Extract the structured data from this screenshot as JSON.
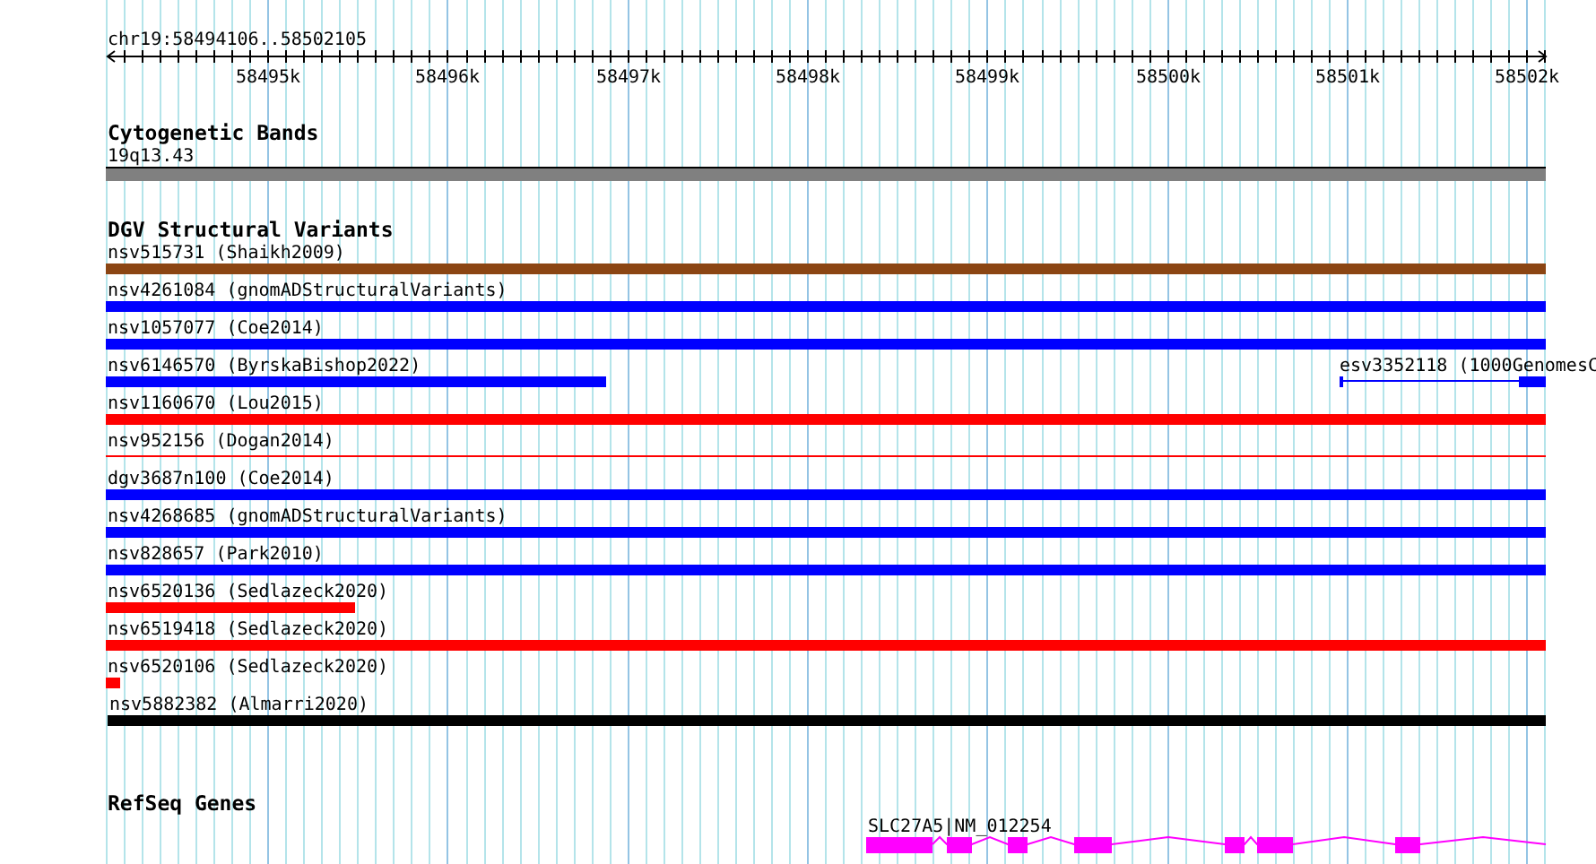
{
  "ruler": {
    "location": "chr19:58494106..58502105",
    "ticks": [
      "58495k",
      "58496k",
      "58497k",
      "58498k",
      "58499k",
      "58500k",
      "58501k",
      "58502k"
    ]
  },
  "tracks": [
    {
      "title": "Cytogenetic Bands",
      "features": [
        {
          "label": "19q13.43",
          "kind": "band"
        }
      ]
    },
    {
      "title": "DGV Structural Variants",
      "features": [
        {
          "label": "nsv515731 (Shaikh2009)",
          "kind": "bar",
          "color": "#8b4513"
        },
        {
          "label": "nsv4261084 (gnomADStructuralVariants)",
          "kind": "bar",
          "color": "#0000ff"
        },
        {
          "label": "nsv1057077 (Coe2014)",
          "kind": "bar",
          "color": "#0000ff"
        },
        {
          "label": "nsv6146570 (ByrskaBishop2022)",
          "kind": "bar",
          "color": "#0000ff"
        },
        {
          "label": "esv3352118 (1000GenomesC",
          "kind": "split",
          "color": "#0000ff"
        },
        {
          "label": "nsv1160670 (Lou2015)",
          "kind": "bar",
          "color": "#ff0000"
        },
        {
          "label": "nsv952156 (Dogan2014)",
          "kind": "line",
          "color": "#ff0000"
        },
        {
          "label": "dgv3687n100 (Coe2014)",
          "kind": "bar",
          "color": "#0000ff"
        },
        {
          "label": "nsv4268685 (gnomADStructuralVariants)",
          "kind": "bar",
          "color": "#0000ff"
        },
        {
          "label": "nsv828657 (Park2010)",
          "kind": "bar",
          "color": "#0000ff"
        },
        {
          "label": "nsv6520136 (Sedlazeck2020)",
          "kind": "bar",
          "color": "#ff0000"
        },
        {
          "label": "nsv6519418 (Sedlazeck2020)",
          "kind": "bar",
          "color": "#ff0000"
        },
        {
          "label": "nsv6520106 (Sedlazeck2020)",
          "kind": "bar",
          "color": "#ff0000"
        },
        {
          "label": "nsv5882382 (Almarri2020)",
          "kind": "bar",
          "color": "#000000"
        }
      ]
    },
    {
      "title": "RefSeq Genes",
      "features": [
        {
          "label": "SLC27A5|NM_012254",
          "kind": "gene"
        }
      ]
    }
  ]
}
